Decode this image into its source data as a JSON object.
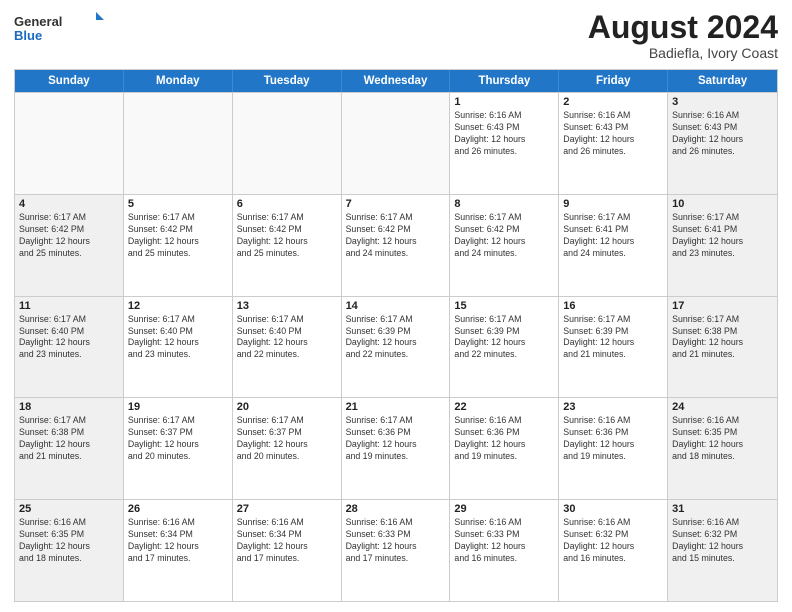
{
  "logo": {
    "general": "General",
    "blue": "Blue"
  },
  "header": {
    "month_year": "August 2024",
    "location": "Badiefla, Ivory Coast"
  },
  "weekdays": [
    "Sunday",
    "Monday",
    "Tuesday",
    "Wednesday",
    "Thursday",
    "Friday",
    "Saturday"
  ],
  "weeks": [
    [
      {
        "day": "",
        "info": "",
        "empty": true
      },
      {
        "day": "",
        "info": "",
        "empty": true
      },
      {
        "day": "",
        "info": "",
        "empty": true
      },
      {
        "day": "",
        "info": "",
        "empty": true
      },
      {
        "day": "1",
        "info": "Sunrise: 6:16 AM\nSunset: 6:43 PM\nDaylight: 12 hours\nand 26 minutes."
      },
      {
        "day": "2",
        "info": "Sunrise: 6:16 AM\nSunset: 6:43 PM\nDaylight: 12 hours\nand 26 minutes."
      },
      {
        "day": "3",
        "info": "Sunrise: 6:16 AM\nSunset: 6:43 PM\nDaylight: 12 hours\nand 26 minutes."
      }
    ],
    [
      {
        "day": "4",
        "info": "Sunrise: 6:17 AM\nSunset: 6:42 PM\nDaylight: 12 hours\nand 25 minutes."
      },
      {
        "day": "5",
        "info": "Sunrise: 6:17 AM\nSunset: 6:42 PM\nDaylight: 12 hours\nand 25 minutes."
      },
      {
        "day": "6",
        "info": "Sunrise: 6:17 AM\nSunset: 6:42 PM\nDaylight: 12 hours\nand 25 minutes."
      },
      {
        "day": "7",
        "info": "Sunrise: 6:17 AM\nSunset: 6:42 PM\nDaylight: 12 hours\nand 24 minutes."
      },
      {
        "day": "8",
        "info": "Sunrise: 6:17 AM\nSunset: 6:42 PM\nDaylight: 12 hours\nand 24 minutes."
      },
      {
        "day": "9",
        "info": "Sunrise: 6:17 AM\nSunset: 6:41 PM\nDaylight: 12 hours\nand 24 minutes."
      },
      {
        "day": "10",
        "info": "Sunrise: 6:17 AM\nSunset: 6:41 PM\nDaylight: 12 hours\nand 23 minutes."
      }
    ],
    [
      {
        "day": "11",
        "info": "Sunrise: 6:17 AM\nSunset: 6:40 PM\nDaylight: 12 hours\nand 23 minutes."
      },
      {
        "day": "12",
        "info": "Sunrise: 6:17 AM\nSunset: 6:40 PM\nDaylight: 12 hours\nand 23 minutes."
      },
      {
        "day": "13",
        "info": "Sunrise: 6:17 AM\nSunset: 6:40 PM\nDaylight: 12 hours\nand 22 minutes."
      },
      {
        "day": "14",
        "info": "Sunrise: 6:17 AM\nSunset: 6:39 PM\nDaylight: 12 hours\nand 22 minutes."
      },
      {
        "day": "15",
        "info": "Sunrise: 6:17 AM\nSunset: 6:39 PM\nDaylight: 12 hours\nand 22 minutes."
      },
      {
        "day": "16",
        "info": "Sunrise: 6:17 AM\nSunset: 6:39 PM\nDaylight: 12 hours\nand 21 minutes."
      },
      {
        "day": "17",
        "info": "Sunrise: 6:17 AM\nSunset: 6:38 PM\nDaylight: 12 hours\nand 21 minutes."
      }
    ],
    [
      {
        "day": "18",
        "info": "Sunrise: 6:17 AM\nSunset: 6:38 PM\nDaylight: 12 hours\nand 21 minutes."
      },
      {
        "day": "19",
        "info": "Sunrise: 6:17 AM\nSunset: 6:37 PM\nDaylight: 12 hours\nand 20 minutes."
      },
      {
        "day": "20",
        "info": "Sunrise: 6:17 AM\nSunset: 6:37 PM\nDaylight: 12 hours\nand 20 minutes."
      },
      {
        "day": "21",
        "info": "Sunrise: 6:17 AM\nSunset: 6:36 PM\nDaylight: 12 hours\nand 19 minutes."
      },
      {
        "day": "22",
        "info": "Sunrise: 6:16 AM\nSunset: 6:36 PM\nDaylight: 12 hours\nand 19 minutes."
      },
      {
        "day": "23",
        "info": "Sunrise: 6:16 AM\nSunset: 6:36 PM\nDaylight: 12 hours\nand 19 minutes."
      },
      {
        "day": "24",
        "info": "Sunrise: 6:16 AM\nSunset: 6:35 PM\nDaylight: 12 hours\nand 18 minutes."
      }
    ],
    [
      {
        "day": "25",
        "info": "Sunrise: 6:16 AM\nSunset: 6:35 PM\nDaylight: 12 hours\nand 18 minutes."
      },
      {
        "day": "26",
        "info": "Sunrise: 6:16 AM\nSunset: 6:34 PM\nDaylight: 12 hours\nand 17 minutes."
      },
      {
        "day": "27",
        "info": "Sunrise: 6:16 AM\nSunset: 6:34 PM\nDaylight: 12 hours\nand 17 minutes."
      },
      {
        "day": "28",
        "info": "Sunrise: 6:16 AM\nSunset: 6:33 PM\nDaylight: 12 hours\nand 17 minutes."
      },
      {
        "day": "29",
        "info": "Sunrise: 6:16 AM\nSunset: 6:33 PM\nDaylight: 12 hours\nand 16 minutes."
      },
      {
        "day": "30",
        "info": "Sunrise: 6:16 AM\nSunset: 6:32 PM\nDaylight: 12 hours\nand 16 minutes."
      },
      {
        "day": "31",
        "info": "Sunrise: 6:16 AM\nSunset: 6:32 PM\nDaylight: 12 hours\nand 15 minutes."
      }
    ]
  ]
}
